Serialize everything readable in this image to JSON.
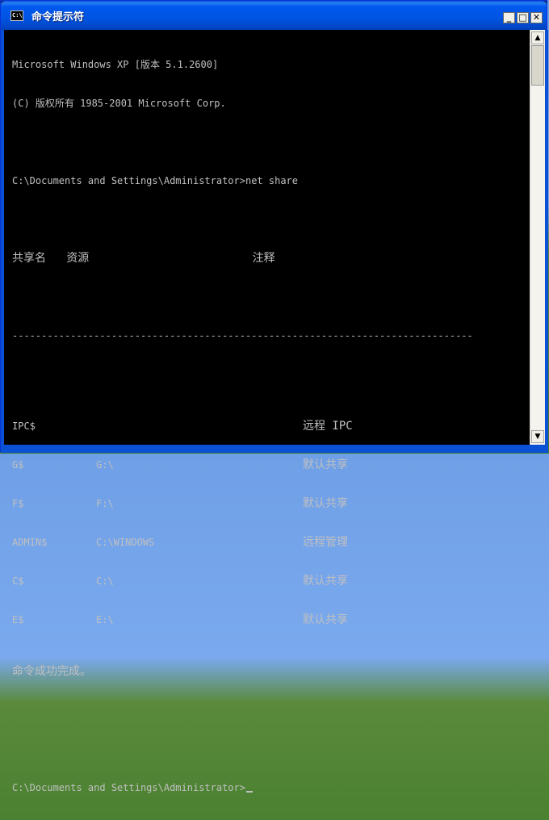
{
  "window": {
    "title": "命令提示符",
    "icon_label": "C:\\",
    "buttons": {
      "minimize": "_",
      "maximize": "□",
      "close": "✕"
    }
  },
  "console": {
    "header1": "Microsoft Windows XP [版本 5.1.2600]",
    "header2": "(C) 版权所有 1985-2001 Microsoft Corp.",
    "command1": "C:\\Documents and Settings\\Administrator>net share",
    "col_headers": "共享名   资源                        注释",
    "separator": "-------------------------------------------------------------------------------",
    "shares": [
      {
        "name": "IPC$",
        "resource": "",
        "remark": "远程 IPC"
      },
      {
        "name": "G$",
        "resource": "G:\\",
        "remark": "默认共享"
      },
      {
        "name": "F$",
        "resource": "F:\\",
        "remark": "默认共享"
      },
      {
        "name": "ADMIN$",
        "resource": "C:\\WINDOWS",
        "remark": "远程管理"
      },
      {
        "name": "C$",
        "resource": "C:\\",
        "remark": "默认共享"
      },
      {
        "name": "E$",
        "resource": "E:\\",
        "remark": "默认共享"
      }
    ],
    "result": "命令成功完成。",
    "prompt": "C:\\Documents and Settings\\Administrator>"
  },
  "scrollbar": {
    "up_arrow": "▲",
    "down_arrow": "▼"
  }
}
